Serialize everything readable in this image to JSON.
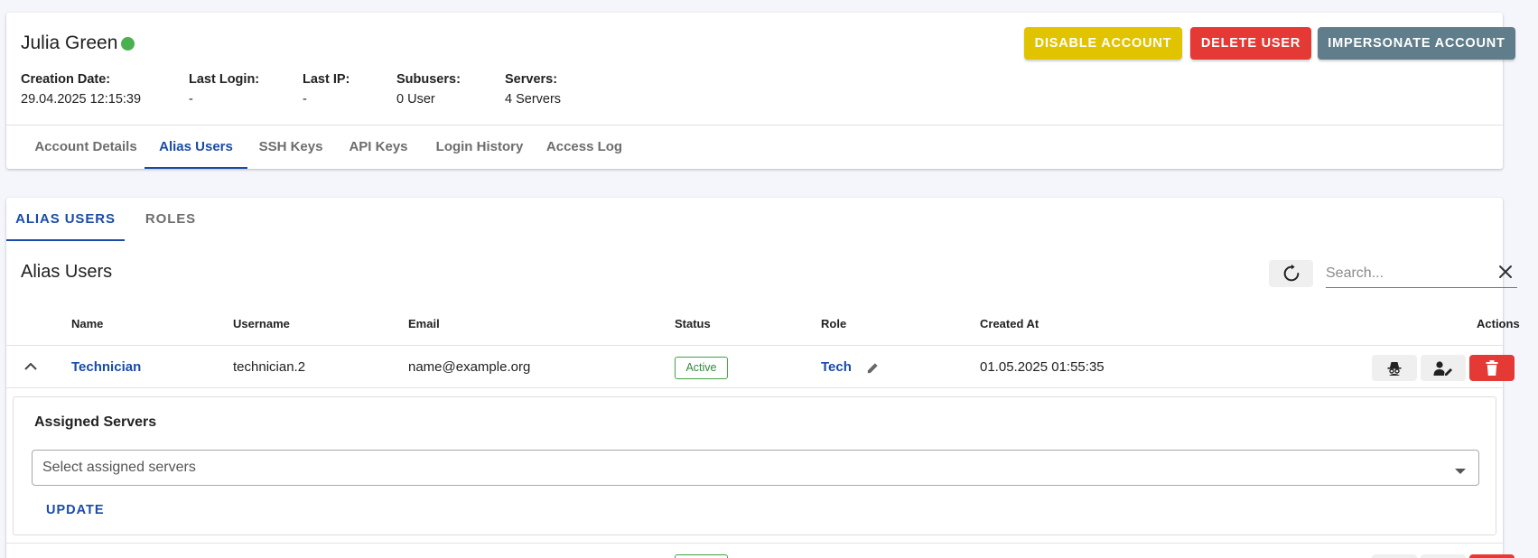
{
  "user": {
    "name": "Julia Green",
    "status_color": "#4caf50"
  },
  "header_actions": {
    "disable_label": "DISABLE ACCOUNT",
    "delete_label": "DELETE USER",
    "impersonate_label": "IMPERSONATE ACCOUNT"
  },
  "meta": {
    "creation_date_label": "Creation Date:",
    "creation_date_value": "29.04.2025 12:15:39",
    "last_login_label": "Last Login:",
    "last_login_value": "-",
    "last_ip_label": "Last IP:",
    "last_ip_value": "-",
    "subusers_label": "Subusers:",
    "subusers_value": "0 User",
    "servers_label": "Servers:",
    "servers_value": "4 Servers"
  },
  "account_tabs": [
    "Account Details",
    "Alias Users",
    "SSH Keys",
    "API Keys",
    "Login History",
    "Access Log"
  ],
  "account_tab_active": "Alias Users",
  "section_tabs": [
    "ALIAS USERS",
    "ROLES"
  ],
  "section_tab_active": "ALIAS USERS",
  "alias_users": {
    "title": "Alias Users",
    "search_placeholder": "Search...",
    "columns": {
      "name": "Name",
      "username": "Username",
      "email": "Email",
      "status": "Status",
      "role": "Role",
      "created_at": "Created At",
      "actions": "Actions"
    },
    "rows": [
      {
        "name": "Technician",
        "username": "technician.2",
        "email": "name@example.org",
        "status": "Active",
        "role": "Tech",
        "created_at": "01.05.2025 01:55:35",
        "expanded": true
      }
    ],
    "expanded_panel": {
      "title": "Assigned Servers",
      "select_placeholder": "Select assigned servers",
      "update_label": "UPDATE"
    }
  },
  "icons": {
    "refresh": "refresh-icon",
    "clear": "close-icon",
    "collapse": "chevron-up-icon",
    "edit_role": "pencil-icon",
    "impersonate": "spy-icon",
    "edit_user": "user-edit-icon",
    "delete": "trash-icon",
    "select_arrow": "caret-down-icon"
  },
  "colors": {
    "accent": "#1a4ba8",
    "warning": "#e2c300",
    "danger": "#e53935",
    "neutral": "#607d8b",
    "success": "#43a047"
  }
}
